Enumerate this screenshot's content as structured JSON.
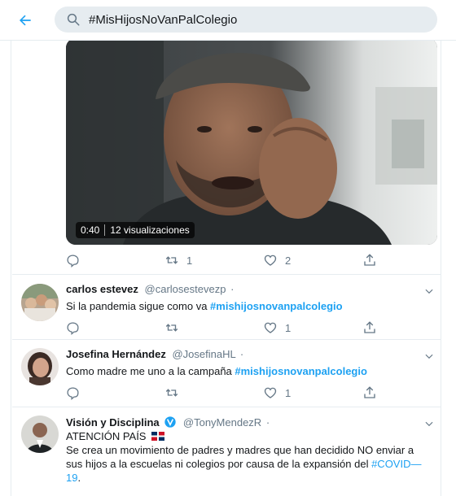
{
  "search": {
    "query": "#MisHijosNoVanPalColegio"
  },
  "media_tweet": {
    "video_duration": "0:40",
    "video_views": "12 visualizaciones",
    "actions": {
      "reply": "",
      "retweet": "1",
      "like": "2"
    }
  },
  "tweets": [
    {
      "name": "carlos estevez",
      "handle": "@carlosestevezp",
      "text": "Si la pandemia sigue como va ",
      "hashtag": "#mishijosnovanpalcolegio",
      "actions": {
        "reply": "",
        "retweet": "",
        "like": "1"
      }
    },
    {
      "name": "Josefina Hernández",
      "handle": "@JosefinaHL",
      "text": "Como madre me uno a la campaña ",
      "hashtag": "#mishijosnovanpalcolegio",
      "actions": {
        "reply": "",
        "retweet": "",
        "like": "1"
      }
    },
    {
      "name": "Visión y Disciplina",
      "handle": "@TonyMendezR",
      "line1": "ATENCIÓN PAÍS",
      "text": "Se crea un movimiento de padres y madres que han decidido NO enviar a sus hijos a la escuelas ni colegios por causa de la expansión del ",
      "hashtag": "#COVID—19",
      "text_end": "."
    }
  ],
  "colors": {
    "accent": "#1da1f2",
    "secondary_text": "#657786",
    "border": "#e6ecf0"
  }
}
